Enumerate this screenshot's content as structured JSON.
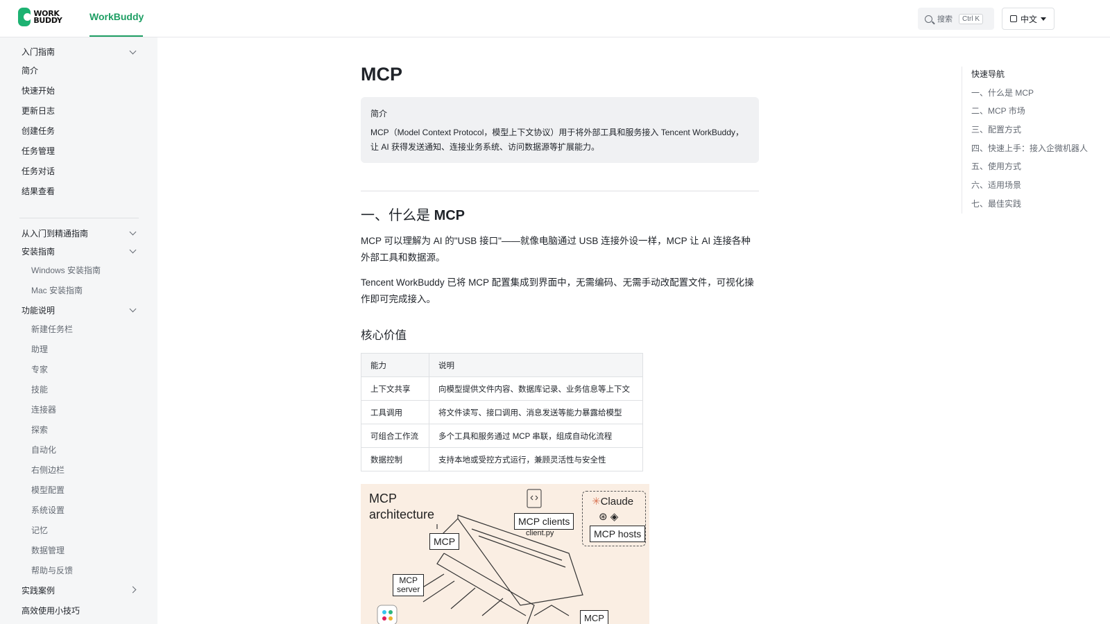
{
  "header": {
    "logo_text": "WORK BUDDY",
    "brand": "WorkBuddy",
    "search_placeholder": "搜索",
    "search_shortcut": "Ctrl K",
    "language": "中文"
  },
  "sidebar": {
    "section1": {
      "title": "入门指南",
      "items": [
        "简介",
        "快速开始",
        "更新日志",
        "创建任务",
        "任务管理",
        "任务对话",
        "结果查看"
      ]
    },
    "section2": {
      "title": "从入门到精通指南"
    },
    "install": {
      "title": "安装指南",
      "items": [
        "Windows 安装指南",
        "Mac 安装指南"
      ]
    },
    "features": {
      "title": "功能说明",
      "items": [
        "新建任务栏",
        "助理",
        "专家",
        "技能",
        "连接器",
        "探索",
        "自动化",
        "右侧边栏",
        "模型配置",
        "系统设置",
        "记忆",
        "数据管理",
        "帮助与反馈"
      ]
    },
    "cases": {
      "title": "实践案例"
    },
    "tips": {
      "title": "高效使用小技巧"
    }
  },
  "main": {
    "title": "MCP",
    "intro_label": "简介",
    "intro_line1": "MCP（Model Context Protocol，模型上下文协议）用于将外部工具和服务接入 Tencent WorkBuddy，",
    "intro_line2": "让 AI 获得发送通知、连接业务系统、访问数据源等扩展能力。",
    "section1_prefix": "一、什么是",
    "section1_bold": "MCP",
    "para1": "MCP 可以理解为 AI 的\"USB 接口\"——就像电脑通过 USB 连接外设一样，MCP 让 AI 连接各种外部工具和数据源。",
    "para2": "Tencent WorkBuddy 已将 MCP 配置集成到界面中，无需编码、无需手动改配置文件，可视化操作即可完成接入。",
    "core_value_heading": "核心价值",
    "table": {
      "headers": [
        "能力",
        "说明"
      ],
      "rows": [
        [
          "上下文共享",
          "向模型提供文件内容、数据库记录、业务信息等上下文"
        ],
        [
          "工具调用",
          "将文件读写、接口调用、消息发送等能力暴露给模型"
        ],
        [
          "可组合工作流",
          "多个工具和服务通过 MCP 串联，组成自动化流程"
        ],
        [
          "数据控制",
          "支持本地或受控方式运行，兼顾灵活性与安全性"
        ]
      ]
    },
    "diagram": {
      "title_line1": "MCP",
      "title_line2": "architecture",
      "clients": "MCP clients",
      "client_file": "client.py",
      "claude": "Claude",
      "hosts": "MCP hosts",
      "mcp": "MCP",
      "server_line1": "MCP",
      "server_line2": "server",
      "mcp_bottom": "MCP"
    }
  },
  "toc": {
    "title": "快速导航",
    "items": [
      "一、什么是 MCP",
      "二、MCP 市场",
      "三、配置方式",
      "四、快速上手：接入企微机器人",
      "五、使用方式",
      "六、适用场景",
      "七、最佳实践"
    ]
  }
}
